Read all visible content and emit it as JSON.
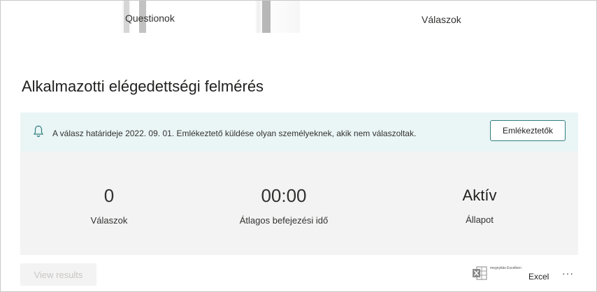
{
  "tabs": {
    "questions_label": "Questionok",
    "responses_label": "Válaszok"
  },
  "page_title": "Alkalmazotti elégedettségi felmérés",
  "banner": {
    "text": "A válasz határideje 2022. 09. 01. Emlékeztető küldése olyan személyeknek, akik nem válaszoltak.",
    "button_label": "Emlékeztetők",
    "icon": "bell-icon"
  },
  "stats": {
    "responses": {
      "value": "0",
      "label": "Válaszok"
    },
    "avg_time": {
      "value": "00:00",
      "label": "Átlagos befejezési idő"
    },
    "status": {
      "value": "Aktív",
      "label": "Állapot"
    }
  },
  "footer": {
    "view_results_label": "View results",
    "excel_small_text": "megnyitás Excelben",
    "excel_label": "Excel",
    "more_label": "···"
  },
  "colors": {
    "banner_bg": "#eaf5f5",
    "panel_bg": "#f3f3f3",
    "accent": "#2f7f7f",
    "disabled_text": "#c8c6c4"
  }
}
